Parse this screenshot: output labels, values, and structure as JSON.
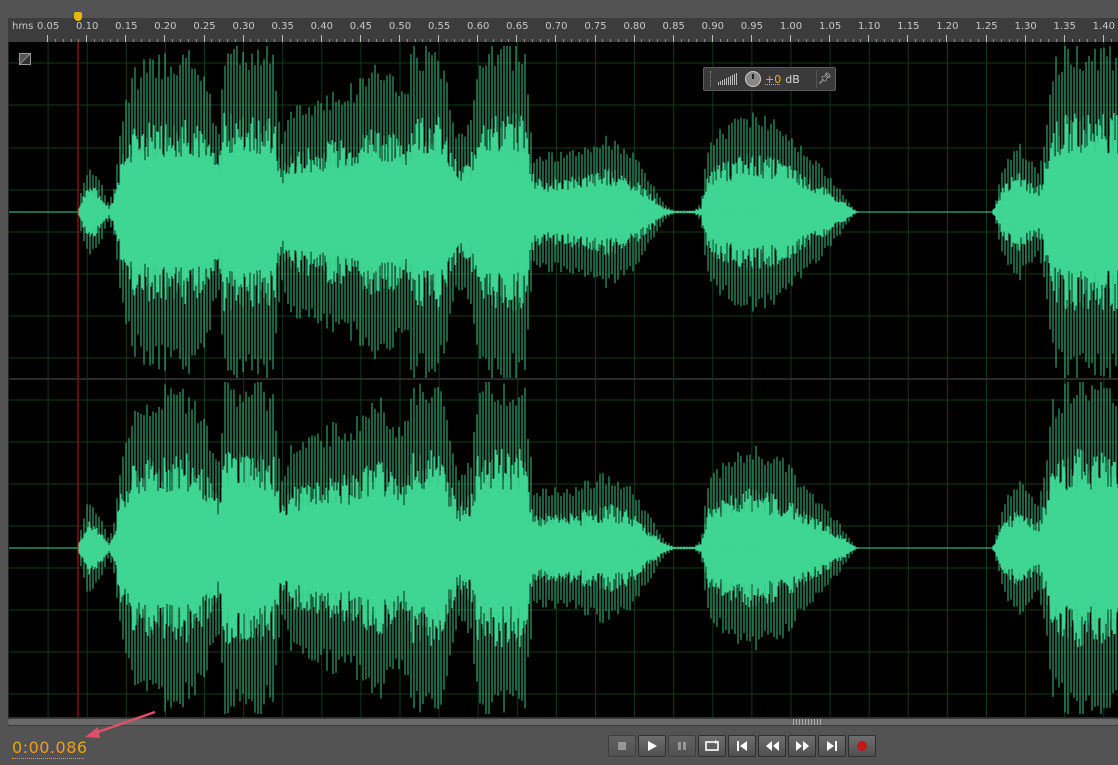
{
  "ruler": {
    "unit_label": "hms",
    "ticks": [
      "0.05",
      "0.10",
      "0.15",
      "0.20",
      "0.25",
      "0.30",
      "0.35",
      "0.40",
      "0.45",
      "0.50",
      "0.55",
      "0.60",
      "0.65",
      "0.70",
      "0.75",
      "0.80",
      "0.85",
      "0.90",
      "0.95",
      "1.00",
      "1.05",
      "1.10",
      "1.15",
      "1.20",
      "1.25",
      "1.30",
      "1.35",
      "1.40"
    ]
  },
  "hud": {
    "gain_value": "+0",
    "gain_unit": "dB"
  },
  "time_display": "0:00.086",
  "colors": {
    "waveform": "#3fd592",
    "playhead": "#c81818",
    "time_text": "#e8a317",
    "annotation_arrow": "#e0506a"
  },
  "transport": {
    "buttons": [
      {
        "name": "stop-button",
        "icon": "stop-icon",
        "enabled": false
      },
      {
        "name": "play-button",
        "icon": "play-icon",
        "enabled": true
      },
      {
        "name": "pause-button",
        "icon": "pause-icon",
        "enabled": false
      },
      {
        "name": "loop-button",
        "icon": "loop-icon",
        "enabled": true
      },
      {
        "name": "go-to-start-button",
        "icon": "skip-start-icon",
        "enabled": true
      },
      {
        "name": "rewind-button",
        "icon": "rewind-icon",
        "enabled": true
      },
      {
        "name": "fast-forward-button",
        "icon": "fast-forward-icon",
        "enabled": true
      },
      {
        "name": "go-to-end-button",
        "icon": "skip-end-icon",
        "enabled": true
      },
      {
        "name": "record-button",
        "icon": "record-icon",
        "enabled": true
      }
    ]
  }
}
